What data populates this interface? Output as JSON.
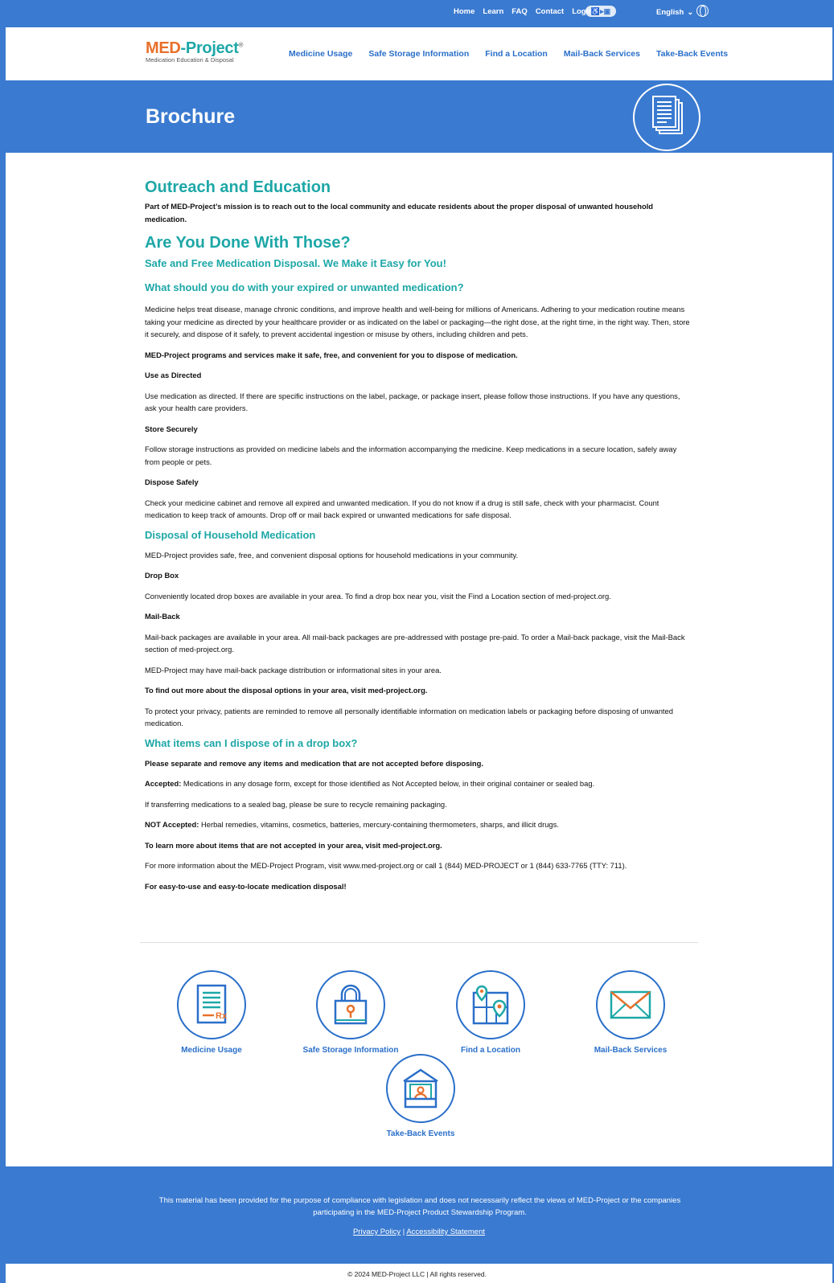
{
  "topbar": {
    "links": [
      "Home",
      "Learn",
      "FAQ",
      "Contact",
      "Login"
    ],
    "language": "English"
  },
  "logo": {
    "name_med": "MED",
    "name_project": "-Project",
    "tagline": "Medication Education & Disposal"
  },
  "nav": [
    "Medicine Usage",
    "Safe Storage Information",
    "Find a Location",
    "Mail-Back Services",
    "Take-Back Events"
  ],
  "hero": {
    "title": "Brochure",
    "icon": "documents-icon"
  },
  "content": {
    "h_outreach": "Outreach and Education",
    "p_outreach": "Part of MED-Project’s mission is to reach out to the local community and educate residents about the proper disposal of unwanted household medication.",
    "h_done": "Are You Done With Those?",
    "h_safe": "Safe and Free Medication Disposal. We Make it Easy for You!",
    "h_what": "What should you do with your expired or unwanted medication?",
    "p_medicine": "Medicine helps treat disease, manage chronic conditions, and improve health and well-being for millions of Americans. Adhering to your medication routine means taking your medicine as directed by your healthcare provider or as indicated on the label or packaging—the right dose, at the right time, in the right way. Then, store it securely, and dispose of it safely, to prevent accidental ingestion or misuse by others, including children and pets.",
    "p_programs": "MED-Project programs and services make it safe, free, and convenient for you to dispose of medication.",
    "h_use": "Use as Directed",
    "p_use": "Use medication as directed. If there are specific instructions on the label, package, or package insert, please follow those instructions. If you have any questions, ask your health care providers.",
    "h_store": "Store Securely",
    "p_store": "Follow storage instructions as provided on medicine labels and the information accompanying the medicine. Keep medications in a secure location, safely away from people or pets.",
    "h_dispose": "Dispose Safely",
    "p_dispose": "Check your medicine cabinet and remove all expired and unwanted medication. If you do not know if a drug is still safe, check with your pharmacist. Count medication to keep track of amounts. Drop off or mail back expired or unwanted medications for safe disposal.",
    "h_household": "Disposal of Household Medication",
    "p_household": "MED-Project provides safe, free, and convenient disposal options for household medications in your community.",
    "h_dropbox": "Drop Box",
    "p_dropbox": "Conveniently located drop boxes are available in your area. To find a drop box near you, visit the Find a Location section of med-project.org.",
    "h_mailback": "Mail-Back",
    "p_mailback": "Mail-back packages are available in your area. All mail-back packages are pre-addressed with postage pre-paid. To order a Mail-back package, visit the Mail-Back section of med-project.org.",
    "p_distribution": "MED-Project may have mail-back package distribution or informational sites in your area.",
    "p_findout": "To find out more about the disposal options in your area, visit med-project.org.",
    "p_privacy": "To protect your privacy, patients are reminded to remove all personally identifiable information on medication labels or packaging before disposing of unwanted medication.",
    "h_items": "What items can I dispose of in a drop box?",
    "p_separate": "Please separate and remove any items and medication that are not accepted before disposing.",
    "accepted_label": "Accepted:",
    "p_accepted": " Medications in any dosage form, except for those identified as Not Accepted below, in their original container or sealed bag.",
    "p_transfer": "If transferring medications to a sealed bag, please be sure to recycle remaining packaging.",
    "not_accepted_label": "NOT Accepted:",
    "p_not_accepted": " Herbal remedies, vitamins, cosmetics, batteries, mercury-containing thermometers, sharps, and illicit drugs.",
    "p_learnmore": "To learn more about items that are not accepted in your area, visit med-project.org.",
    "p_moreinfo": "For more information about the MED-Project Program, visit www.med-project.org or call 1 (844) MED-PROJECT or 1 (844) 633-7765 (TTY: 711).",
    "p_easy": "For easy-to-use and easy-to-locate medication disposal!"
  },
  "cards": [
    {
      "label": "Medicine Usage",
      "icon": "prescription-icon"
    },
    {
      "label": "Safe Storage Information",
      "icon": "padlock-icon"
    },
    {
      "label": "Find a Location",
      "icon": "map-pin-icon"
    },
    {
      "label": "Mail-Back Services",
      "icon": "envelope-icon"
    },
    {
      "label": "Take-Back Events",
      "icon": "booth-icon"
    }
  ],
  "footer": {
    "text": "This material has been provided for the purpose of compliance with legislation and does not necessarily reflect the views of MED-Project or the companies participating in the MED-Project Product Stewardship Program.",
    "privacy": "Privacy Policy",
    "separator": "|",
    "accessibility": "Accessibility Statement",
    "copyright": "© 2024 MED-Project LLC | All rights reserved."
  },
  "colors": {
    "brand_blue": "#3a7ad0",
    "teal": "#1ea7a7",
    "orange": "#e8702a",
    "link_blue": "#2a6fc9"
  }
}
